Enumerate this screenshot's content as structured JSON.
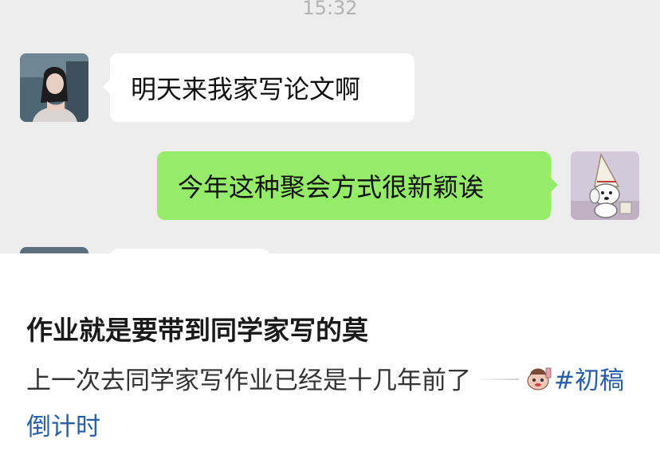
{
  "chat": {
    "timestamp": "15:32",
    "messages": [
      {
        "side": "left",
        "text": "明天来我家写论文啊"
      },
      {
        "side": "right",
        "text": "今年这种聚会方式很新颖诶"
      }
    ]
  },
  "post": {
    "title": "作业就是要带到同学家写的莫",
    "body": "上一次去同学家写作业已经是十几年前了",
    "topic": {
      "icon": "cartoon-sticker-icon",
      "label_part1": "#初稿",
      "label_part2": "倒计时",
      "color": "#2a5fa8"
    }
  },
  "colors": {
    "chat_background": "#ededed",
    "left_bubble": "#ffffff",
    "right_bubble": "#95ec69"
  }
}
